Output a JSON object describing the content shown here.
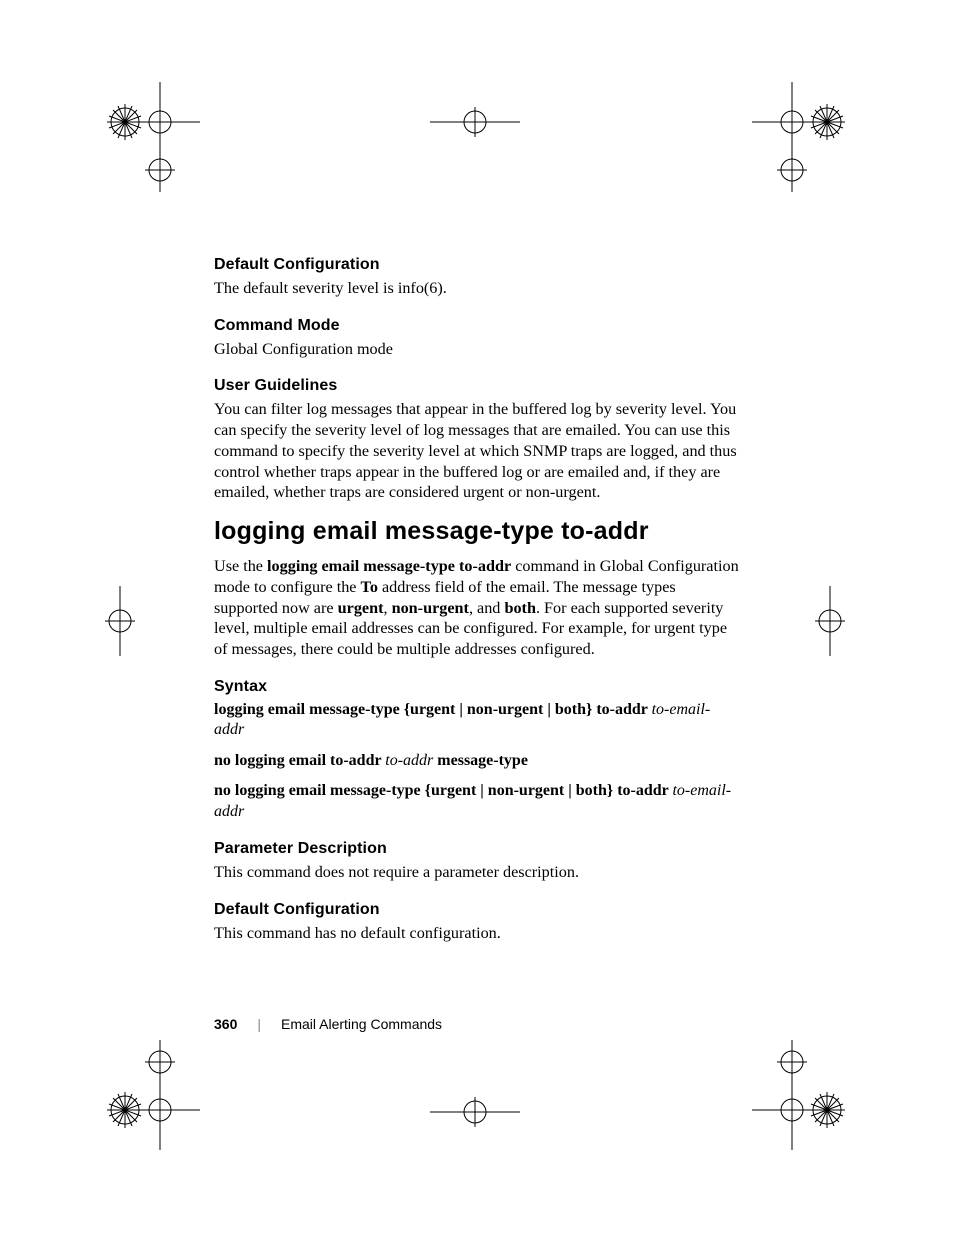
{
  "sections": {
    "defcfg1": {
      "head": "Default Configuration",
      "text": "The default severity level is info(6)."
    },
    "cmdmode": {
      "head": "Command Mode",
      "text": "Global Configuration mode"
    },
    "userg": {
      "head": "User Guidelines",
      "text": "You can filter log messages that appear in the buffered log by severity level. You can specify the severity level of log messages that are emailed. You can use this command to specify the severity level at which SNMP traps are logged, and thus control whether traps appear in the buffered log or are emailed and, if they are emailed, whether traps are considered urgent or non-urgent."
    },
    "title": "logging email message-type to-addr",
    "intro": {
      "p1a": "Use the ",
      "p1b": "logging email message-type to-addr",
      "p1c": " command in Global Configuration mode to configure the ",
      "p1d": "To",
      "p1e": " address field of the email. The message types supported now are ",
      "p1f": "urgent",
      "p1g": ", ",
      "p1h": "non-urgent",
      "p1i": ", and ",
      "p1j": "both",
      "p1k": ". For each supported severity level, multiple email addresses can be configured. For example, for urgent type of messages, there could be multiple addresses configured."
    },
    "syntax": {
      "head": "Syntax",
      "l1a": "logging email message-type {urgent | non-urgent | both} to-addr ",
      "l1b": "to-email-addr",
      "l2a": "no logging email to-addr ",
      "l2b": "to-addr",
      "l2c": " message-type",
      "l3a": "no logging email message-type {urgent  | non-urgent | both} to-addr ",
      "l3b": "to-email-addr"
    },
    "paramdesc": {
      "head": "Parameter Description",
      "text": "This command does not require a parameter description."
    },
    "defcfg2": {
      "head": "Default Configuration",
      "text": "This command has no default configuration."
    }
  },
  "footer": {
    "page": "360",
    "chapter": "Email Alerting Commands"
  }
}
